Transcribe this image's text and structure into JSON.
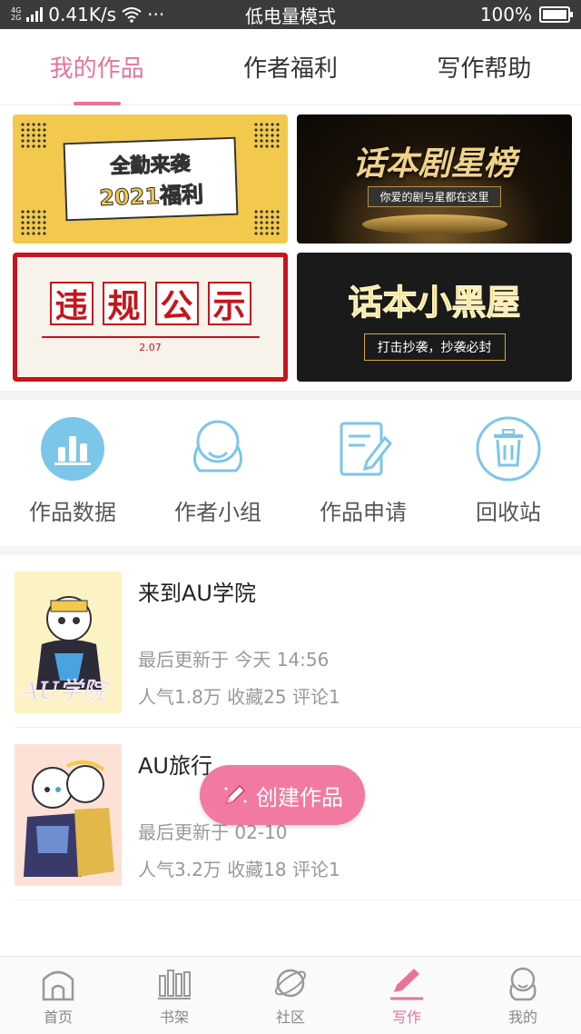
{
  "status_bar": {
    "net_top": "4G",
    "net_bottom": "2G",
    "speed": "0.41K/s",
    "more": "···",
    "mode": "低电量模式",
    "battery": "100%"
  },
  "tabs": [
    {
      "label": "我的作品",
      "active": true
    },
    {
      "label": "作者福利",
      "active": false
    },
    {
      "label": "写作帮助",
      "active": false
    }
  ],
  "banners": {
    "b1_line1": "全勤来袭",
    "b1_line2": "2021福利",
    "b2_title": "话本剧星榜",
    "b2_sub": "你爱的剧与星都在这里",
    "b3_chars": [
      "违",
      "规",
      "公",
      "示"
    ],
    "b3_date": "2.07",
    "b4_title": "话本小黑屋",
    "b4_sub": "打击抄袭，抄袭必封"
  },
  "tools": [
    {
      "label": "作品数据",
      "icon": "bar-chart-icon"
    },
    {
      "label": "作者小组",
      "icon": "group-icon"
    },
    {
      "label": "作品申请",
      "icon": "edit-document-icon"
    },
    {
      "label": "回收站",
      "icon": "trash-icon"
    }
  ],
  "works": [
    {
      "title": "来到AU学院",
      "updated": "最后更新于 今天 14:56",
      "stats": "人气1.8万 收藏25 评论1",
      "cover_text": "AU学院"
    },
    {
      "title": "AU旅行",
      "updated": "最后更新于 02-10",
      "stats": "人气3.2万 收藏18 评论1"
    }
  ],
  "fab": {
    "label": "创建作品"
  },
  "bottom_nav": [
    {
      "label": "首页",
      "icon": "home-icon",
      "active": false
    },
    {
      "label": "书架",
      "icon": "bookshelf-icon",
      "active": false
    },
    {
      "label": "社区",
      "icon": "planet-icon",
      "active": false
    },
    {
      "label": "写作",
      "icon": "pen-icon",
      "active": true
    },
    {
      "label": "我的",
      "icon": "profile-icon",
      "active": false
    }
  ],
  "colors": {
    "accent": "#e8739a",
    "fab": "#f27aa1",
    "icon_blue": "#7cc6ea"
  }
}
